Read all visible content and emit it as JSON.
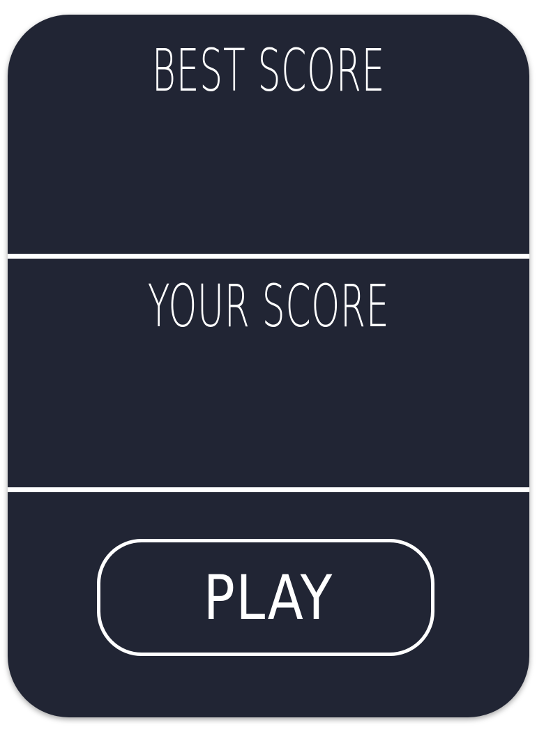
{
  "panel": {
    "best_score_label": "BEST SCORE",
    "best_score_value": "",
    "your_score_label": "YOUR SCORE",
    "your_score_value": "",
    "play_label": "PLAY"
  },
  "colors": {
    "panel_background": "#212534",
    "foreground": "#ffffff",
    "page_background": "#ffffff"
  }
}
